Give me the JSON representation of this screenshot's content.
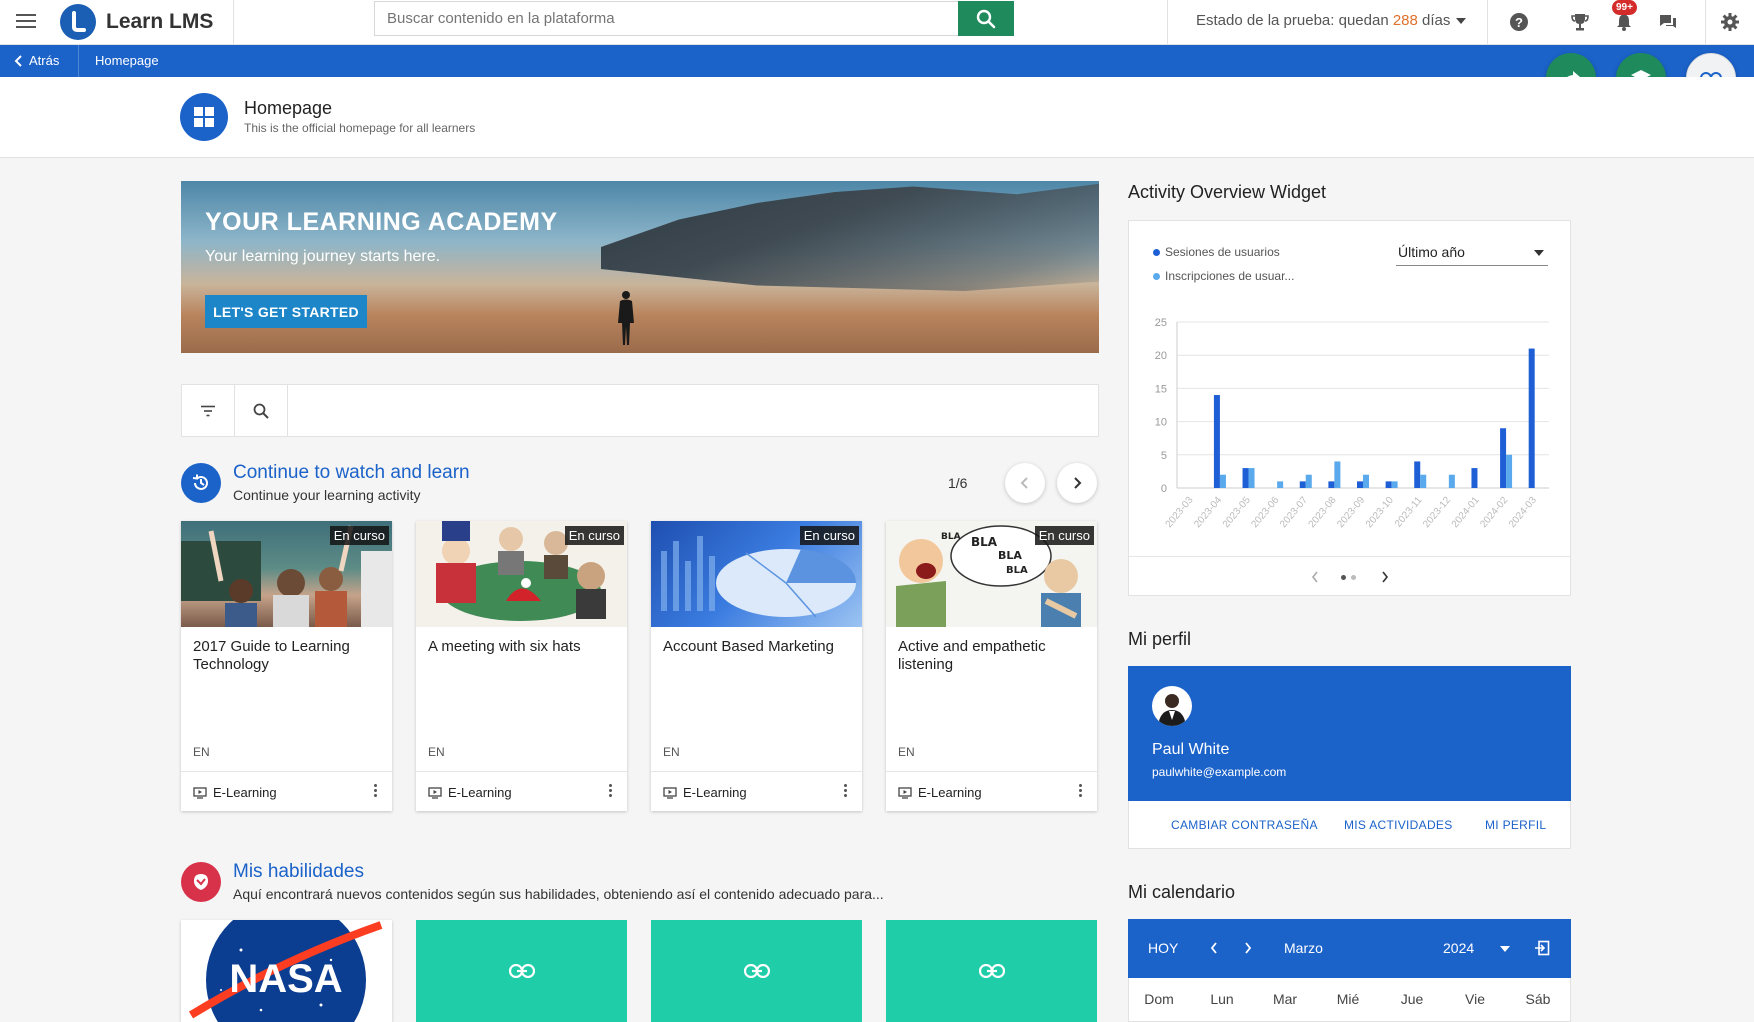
{
  "topbar": {
    "logo_text": "Learn LMS",
    "search_placeholder": "Buscar contenido en la plataforma",
    "trial_prefix": "Estado de la prueba: quedan ",
    "trial_days": "288",
    "trial_suffix": " días",
    "notifications_badge": "99+"
  },
  "breadcrumb": {
    "back_label": "Atrás",
    "current": "Homepage"
  },
  "page": {
    "title": "Homepage",
    "subtitle": "This is the official homepage for all learners"
  },
  "hero": {
    "title": "YOUR LEARNING ACADEMY",
    "subtitle": "Your learning journey starts here.",
    "button": "LET'S GET STARTED"
  },
  "continue_section": {
    "title": "Continue to watch and learn",
    "subtitle": "Continue your learning activity",
    "pager": "1/6",
    "cards": [
      {
        "title": "2017 Guide to Learning Technology",
        "badge": "En curso",
        "lang": "EN",
        "type": "E-Learning"
      },
      {
        "title": "A meeting with six hats",
        "badge": "En curso",
        "lang": "EN",
        "type": "E-Learning"
      },
      {
        "title": "Account Based Marketing",
        "badge": "En curso",
        "lang": "EN",
        "type": "E-Learning"
      },
      {
        "title": "Active and empathetic listening",
        "badge": "En curso",
        "lang": "EN",
        "type": "E-Learning"
      }
    ]
  },
  "skills_section": {
    "title": "Mis habilidades",
    "subtitle": "Aquí encontrará nuevos contenidos según sus habilidades, obteniendo así el contenido adecuado para...",
    "nasa_text": "NASA"
  },
  "activity_widget": {
    "title": "Activity Overview Widget",
    "period": "Último año",
    "colors": {
      "sessions": "#1f5fd6",
      "enrollments": "#5aa9ec"
    }
  },
  "chart_data": {
    "type": "bar",
    "categories": [
      "2023-03",
      "2023-04",
      "2023-05",
      "2023-06",
      "2023-07",
      "2023-08",
      "2023-09",
      "2023-10",
      "2023-11",
      "2023-12",
      "2024-01",
      "2024-02",
      "2024-03"
    ],
    "series": [
      {
        "name": "Sesiones de usuarios",
        "values": [
          0,
          14,
          3,
          0,
          1,
          1,
          1,
          1,
          4,
          0,
          3,
          9,
          21
        ]
      },
      {
        "name": "Inscripciones de usuar...",
        "values": [
          0,
          2,
          3,
          1,
          2,
          4,
          2,
          1,
          2,
          2,
          0,
          5,
          0
        ]
      }
    ],
    "yticks": [
      "0",
      "5",
      "10",
      "15",
      "20",
      "25"
    ],
    "ylim": [
      0,
      25
    ],
    "legend": "top-left",
    "grid": true
  },
  "profile": {
    "section_title": "Mi perfil",
    "name": "Paul White",
    "email": "paulwhite@example.com",
    "links": [
      "CAMBIAR CONTRASEÑA",
      "MIS ACTIVIDADES",
      "MI PERFIL"
    ]
  },
  "calendar": {
    "section_title": "Mi calendario",
    "today": "HOY",
    "month": "Marzo",
    "year": "2024",
    "days": [
      "Dom",
      "Lun",
      "Mar",
      "Mié",
      "Jue",
      "Vie",
      "Sáb"
    ]
  }
}
